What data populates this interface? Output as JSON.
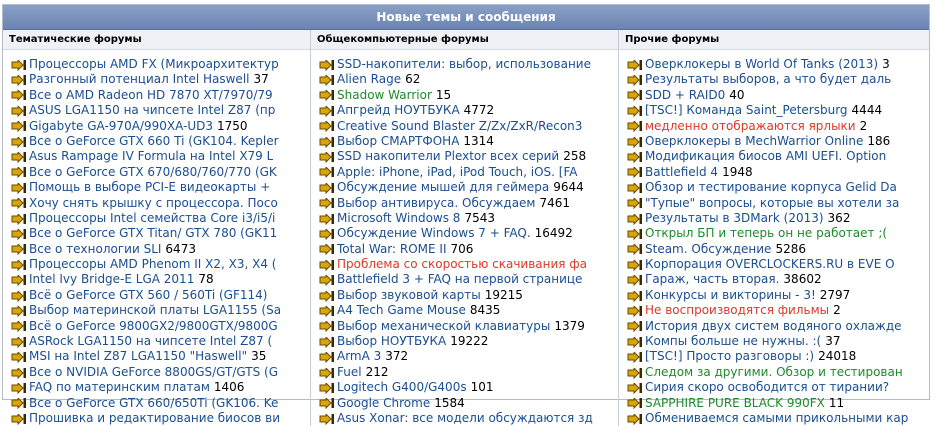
{
  "title": "Новые темы и сообщения",
  "colors": {
    "link": "#1b4e91",
    "red": "#e0372e",
    "green": "#1f8a2a",
    "header": "#7b92bd"
  },
  "columns": [
    {
      "header": "Тематические форумы",
      "items": [
        {
          "text": "Процессоры AMD FX (Микроархитектур",
          "count": ""
        },
        {
          "text": "Разгонный потенциал Intel Haswell",
          "count": "37"
        },
        {
          "text": "Все о AMD Radeon HD 7870 XT/7970/79",
          "count": ""
        },
        {
          "text": "ASUS LGA1150 на чипсете Intel Z87 (пр",
          "count": ""
        },
        {
          "text": "Gigabyte GA-970A/990XA-UD3",
          "count": "1750"
        },
        {
          "text": "Все о GeForce GTX 660 Ti (GK104. Kepler",
          "count": ""
        },
        {
          "text": "Asus Rampage IV Formula на Intel X79 L",
          "count": ""
        },
        {
          "text": "Все о GeForce GTX 670/680/760/770 (GK",
          "count": ""
        },
        {
          "text": "Помощь в выборе PCI-E видеокарты +",
          "count": ""
        },
        {
          "text": "Хочу снять крышку с процессора. Посо",
          "count": ""
        },
        {
          "text": "Процессоры Intel семейства Core i3/i5/i",
          "count": ""
        },
        {
          "text": "Все о GeForce GTX Titan/ GTX 780 (GK11",
          "count": ""
        },
        {
          "text": "Все о технологии SLI",
          "count": "6473"
        },
        {
          "text": "Процессоры AMD Phenom II X2, X3, X4 (",
          "count": ""
        },
        {
          "text": "Intel Ivy Bridge-E LGA 2011",
          "count": "78"
        },
        {
          "text": "Всё о GeForce GTX 560 / 560Ti (GF114)",
          "count": ""
        },
        {
          "text": "Выбор материнской платы LGA1155 (Sa",
          "count": ""
        },
        {
          "text": "Всё о GeForce 9800GX2/9800GTX/9800G",
          "count": ""
        },
        {
          "text": "ASRock LGA1150 на чипсете Intel Z87 (",
          "count": ""
        },
        {
          "text": "MSI на Intel Z87 LGA1150 \"Haswell\"",
          "count": "35"
        },
        {
          "text": "Все о NVIDIA GeForce 8800GS/GT/GTS (G",
          "count": ""
        },
        {
          "text": "FAQ по материнским платам",
          "count": "1406"
        },
        {
          "text": "Все о GeForce GTX 660/650Ti (GK106. Ke",
          "count": ""
        },
        {
          "text": "Прошивка и редактирование биосов ви",
          "count": ""
        }
      ]
    },
    {
      "header": "Общекомпьютерные форумы",
      "items": [
        {
          "text": "SSD-накопители: выбор, использование",
          "count": ""
        },
        {
          "text": "Alien Rage",
          "count": "62"
        },
        {
          "text": "Shadow Warrior",
          "count": "15",
          "color": "green"
        },
        {
          "text": "Апгрейд НОУТБУКА",
          "count": "4772"
        },
        {
          "text": "Creative Sound Blaster Z/Zx/ZxR/Recon3",
          "count": ""
        },
        {
          "text": "Выбор СМАРТФОНА",
          "count": "1314"
        },
        {
          "text": "SSD накопители Plextor всех серий",
          "count": "258"
        },
        {
          "text": "Apple: iPhone, iPad, iPod Touch, iOS. [FA",
          "count": ""
        },
        {
          "text": "Обсуждение мышей для геймера",
          "count": "9644"
        },
        {
          "text": "Выбор антивируса. Обсуждаем",
          "count": "7461"
        },
        {
          "text": "Microsoft Windows 8",
          "count": "7543"
        },
        {
          "text": "Обсуждение Windows 7 + FAQ.",
          "count": "16492"
        },
        {
          "text": "Total War: ROME II",
          "count": "706"
        },
        {
          "text": "Проблема со скоростью скачивания фа",
          "count": "",
          "color": "red"
        },
        {
          "text": "Battlefield 3 + FAQ на первой странице",
          "count": ""
        },
        {
          "text": "Выбор звуковой карты",
          "count": "19215"
        },
        {
          "text": "A4 Tech Game Mouse",
          "count": "8435"
        },
        {
          "text": "Выбор механической клавиатуры",
          "count": "1379"
        },
        {
          "text": "Выбор НОУТБУКА",
          "count": "19222"
        },
        {
          "text": "ArmA 3",
          "count": "372"
        },
        {
          "text": "Fuel",
          "count": "212"
        },
        {
          "text": "Logitech G400/G400s",
          "count": "101"
        },
        {
          "text": "Google Chrome",
          "count": "1584"
        },
        {
          "text": "Asus Xonar: все модели обсуждаются зд",
          "count": ""
        }
      ]
    },
    {
      "header": "Прочие форумы",
      "items": [
        {
          "text": "Оверклокеры в World Of Tanks (2013)",
          "count": "3"
        },
        {
          "text": "Результаты выборов, а что будет даль",
          "count": ""
        },
        {
          "text": "SDD + RAID0",
          "count": "40"
        },
        {
          "text": "[TSC!] Команда Saint_Petersburg",
          "count": "4444"
        },
        {
          "text": "медленно отображаются ярлыки",
          "count": "2",
          "color": "red"
        },
        {
          "text": "Оверклокеры в MechWarrior Online",
          "count": "186"
        },
        {
          "text": "Модификация биосов AMI UEFI. Option",
          "count": ""
        },
        {
          "text": "Battlefield 4",
          "count": "1948"
        },
        {
          "text": "Обзор и тестирование корпуса Gelid Da",
          "count": ""
        },
        {
          "text": "\"Тупые\" вопросы, которые вы хотели за",
          "count": ""
        },
        {
          "text": "Результаты в 3DMark (2013)",
          "count": "362"
        },
        {
          "text": "Открыл БП и теперь он не работает ;(",
          "count": "",
          "color": "green"
        },
        {
          "text": "Steam. Обсуждение",
          "count": "5286"
        },
        {
          "text": "Корпорация OVERCLOCKERS.RU в EVE O",
          "count": ""
        },
        {
          "text": "Гараж, часть вторая.",
          "count": "38602"
        },
        {
          "text": "Конкурсы и викторины - 3!",
          "count": "2797"
        },
        {
          "text": "Не воспроизводятся фильмы",
          "count": "2",
          "color": "red"
        },
        {
          "text": "История двух систем водяного охлажде",
          "count": ""
        },
        {
          "text": "Компы больше не нужны. :(",
          "count": "37"
        },
        {
          "text": "[TSC!] Просто разговоры :)",
          "count": "24018"
        },
        {
          "text": "Следом за другими. Обзор и тестирован",
          "count": "",
          "color": "green"
        },
        {
          "text": "Сирия скоро освободится от тирании?",
          "count": ""
        },
        {
          "text": "SAPPHIRE PURE BLACK 990FX",
          "count": "11",
          "color": "green"
        },
        {
          "text": "Обмениваемся самыми прикольными кар",
          "count": ""
        }
      ]
    }
  ]
}
